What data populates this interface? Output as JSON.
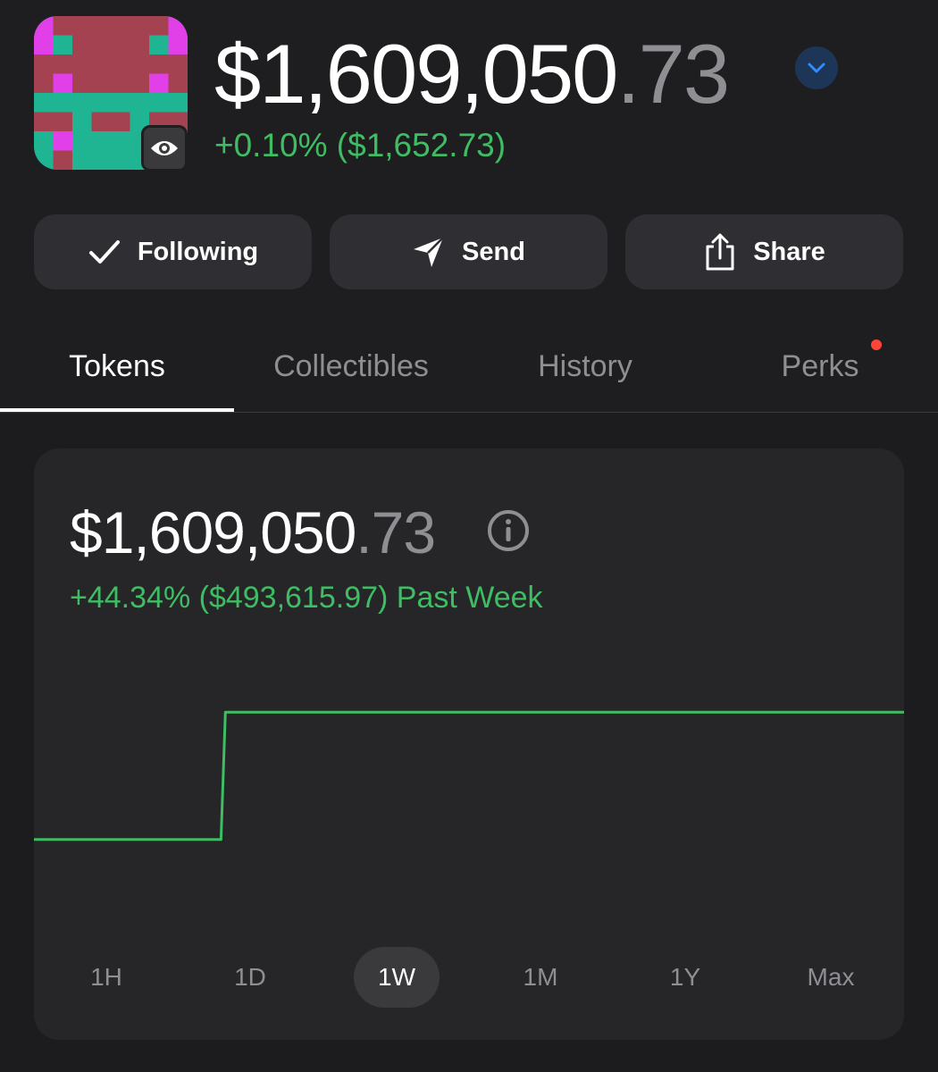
{
  "wallet": {
    "balance_main": "$1,609,050",
    "balance_cents": ".73",
    "change_24h": "+0.10% ($1,652.73)",
    "avatar_icon": "pixel-art-avatar",
    "visibility_icon": "eye-icon",
    "dropdown_icon": "chevron-down-icon"
  },
  "actions": {
    "following": "Following",
    "send": "Send",
    "share": "Share"
  },
  "tabs": [
    {
      "label": "Tokens",
      "active": true
    },
    {
      "label": "Collectibles",
      "active": false
    },
    {
      "label": "History",
      "active": false
    },
    {
      "label": "Perks",
      "active": false,
      "notification": true
    }
  ],
  "card": {
    "balance_main": "$1,609,050",
    "balance_cents": ".73",
    "change": "+44.34% ($493,615.97) Past Week"
  },
  "ranges": [
    {
      "label": "1H",
      "active": false
    },
    {
      "label": "1D",
      "active": false
    },
    {
      "label": "1W",
      "active": true
    },
    {
      "label": "1M",
      "active": false
    },
    {
      "label": "1Y",
      "active": false
    },
    {
      "label": "Max",
      "active": false
    }
  ],
  "colors": {
    "accent_green": "#3ebd63",
    "background": "#1c1c1e",
    "card": "#262629",
    "notification": "#ff453a"
  },
  "chart_data": {
    "type": "line",
    "title": "",
    "xlabel": "",
    "ylabel": "",
    "x": [
      0,
      0.21,
      0.215,
      0.22,
      1.0
    ],
    "values": [
      1115434.76,
      1115434.76,
      1115434.76,
      1609050.73,
      1609050.73
    ],
    "ylim": [
      900000,
      1800000
    ],
    "grid": false
  }
}
